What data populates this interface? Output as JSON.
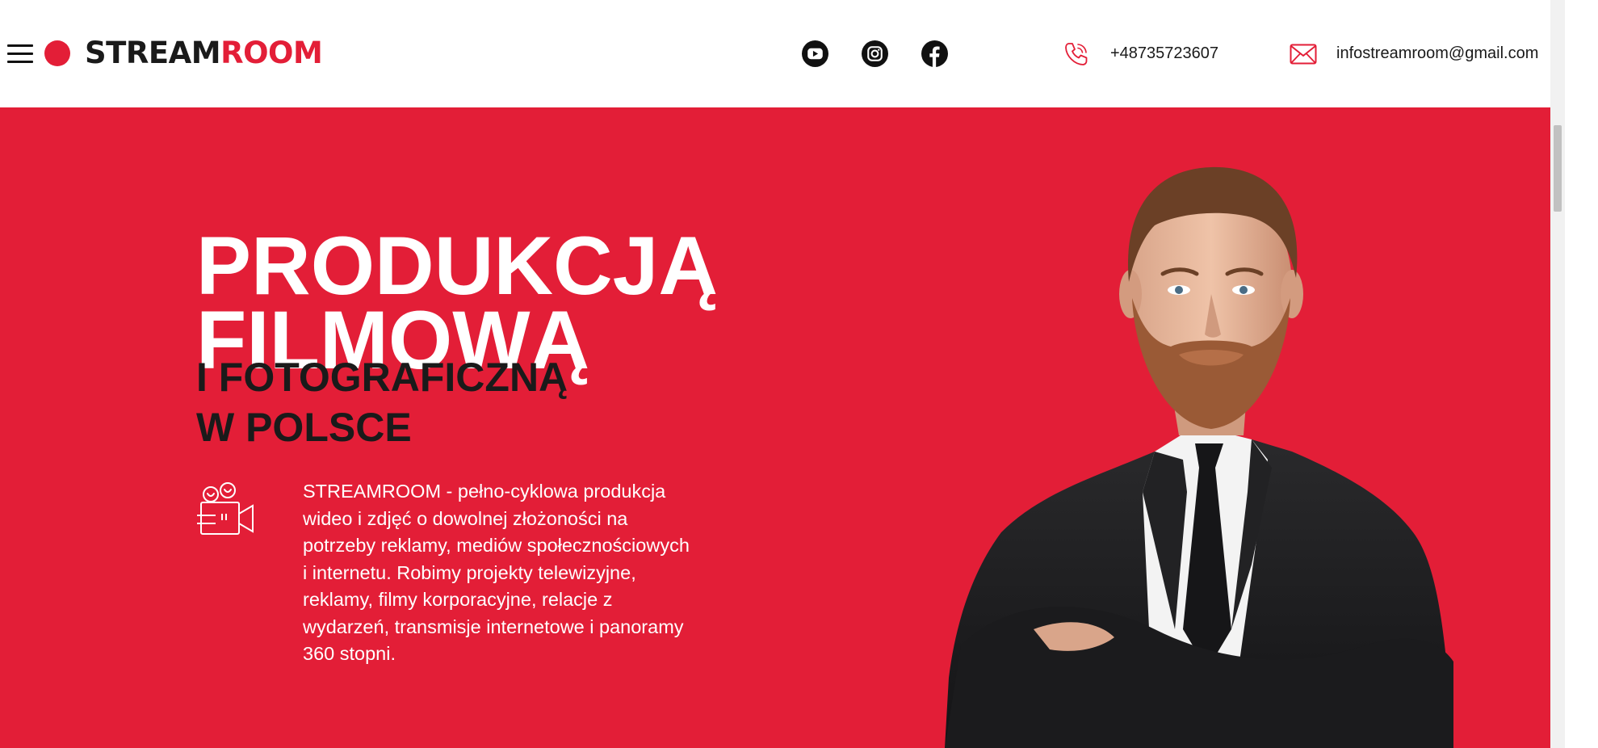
{
  "header": {
    "logo": {
      "part1": "STREAM",
      "part2": "ROOM"
    },
    "menu_icon": "hamburger-menu-icon",
    "social": [
      {
        "name": "youtube",
        "icon": "youtube-icon"
      },
      {
        "name": "instagram",
        "icon": "instagram-icon"
      },
      {
        "name": "facebook",
        "icon": "facebook-icon"
      }
    ],
    "phone": "+48735723607",
    "email": "infostreamroom@gmail.com"
  },
  "hero": {
    "title_line1": "PRODUKCJĄ",
    "title_line2": "FILMOWĄ",
    "subtitle_line1": "I FOTOGRAFICZNĄ",
    "subtitle_line2": "W POLSCE",
    "description": "STREAMROOM - pełno-cyklowa produkcja wideo i zdjęć o dowolnej złożoności na potrzeby reklamy, mediów społecznościowych i internetu. Robimy projekty telewizyjne, reklamy, filmy korporacyjne, relacje z wydarzeń, transmisje internetowe i panoramy 360 stopni."
  },
  "colors": {
    "accent": "#e31e37",
    "text_dark": "#1a1a1a",
    "white": "#ffffff"
  }
}
